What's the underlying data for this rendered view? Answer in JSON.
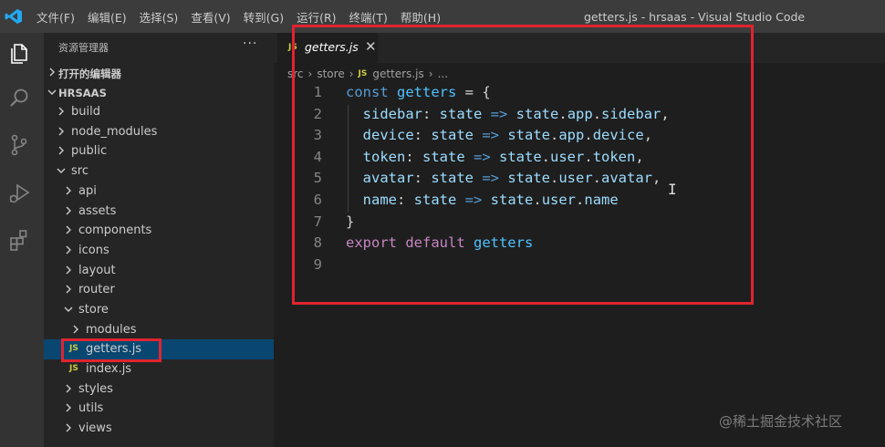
{
  "window": {
    "menu": [
      "文件(F)",
      "编辑(E)",
      "选择(S)",
      "查看(V)",
      "转到(G)",
      "运行(R)",
      "终端(T)",
      "帮助(H)"
    ],
    "title": "getters.js - hrsaas - Visual Studio Code"
  },
  "activity_bar": {
    "items": [
      "files-icon",
      "search-icon",
      "source-control-icon",
      "run-debug-icon",
      "extensions-icon"
    ]
  },
  "sidebar": {
    "header": "资源管理器",
    "more": "···",
    "open_editors": "打开的编辑器",
    "project": "HRSAAS",
    "tree": [
      {
        "label": "build",
        "type": "folder",
        "level": 1,
        "expanded": false
      },
      {
        "label": "node_modules",
        "type": "folder",
        "level": 1,
        "expanded": false
      },
      {
        "label": "public",
        "type": "folder",
        "level": 1,
        "expanded": false
      },
      {
        "label": "src",
        "type": "folder",
        "level": 1,
        "expanded": true
      },
      {
        "label": "api",
        "type": "folder",
        "level": 2,
        "expanded": false
      },
      {
        "label": "assets",
        "type": "folder",
        "level": 2,
        "expanded": false
      },
      {
        "label": "components",
        "type": "folder",
        "level": 2,
        "expanded": false
      },
      {
        "label": "icons",
        "type": "folder",
        "level": 2,
        "expanded": false
      },
      {
        "label": "layout",
        "type": "folder",
        "level": 2,
        "expanded": false
      },
      {
        "label": "router",
        "type": "folder",
        "level": 2,
        "expanded": false
      },
      {
        "label": "store",
        "type": "folder",
        "level": 2,
        "expanded": true
      },
      {
        "label": "modules",
        "type": "folder",
        "level": 3,
        "expanded": false
      },
      {
        "label": "getters.js",
        "type": "file",
        "level": 3,
        "selected": true
      },
      {
        "label": "index.js",
        "type": "file",
        "level": 3
      },
      {
        "label": "styles",
        "type": "folder",
        "level": 2,
        "expanded": false
      },
      {
        "label": "utils",
        "type": "folder",
        "level": 2,
        "expanded": false
      },
      {
        "label": "views",
        "type": "folder",
        "level": 2,
        "expanded": false
      }
    ]
  },
  "editor": {
    "tab": {
      "badge": "JS",
      "label": "getters.js",
      "close": "✕"
    },
    "breadcrumb": [
      "src",
      "store",
      "getters.js",
      "..."
    ],
    "code_lines": [
      [
        {
          "t": "const ",
          "c": "kw"
        },
        {
          "t": "getters",
          "c": "var"
        },
        {
          "t": " = {",
          "c": "pn"
        }
      ],
      [
        {
          "t": "  sidebar",
          "c": "prop"
        },
        {
          "t": ": ",
          "c": "pn"
        },
        {
          "t": "state",
          "c": "prop"
        },
        {
          "t": " => ",
          "c": "kw"
        },
        {
          "t": "state",
          "c": "prop"
        },
        {
          "t": ".",
          "c": "pn"
        },
        {
          "t": "app",
          "c": "prop"
        },
        {
          "t": ".",
          "c": "pn"
        },
        {
          "t": "sidebar",
          "c": "prop"
        },
        {
          "t": ",",
          "c": "pn"
        }
      ],
      [
        {
          "t": "  device",
          "c": "prop"
        },
        {
          "t": ": ",
          "c": "pn"
        },
        {
          "t": "state",
          "c": "prop"
        },
        {
          "t": " => ",
          "c": "kw"
        },
        {
          "t": "state",
          "c": "prop"
        },
        {
          "t": ".",
          "c": "pn"
        },
        {
          "t": "app",
          "c": "prop"
        },
        {
          "t": ".",
          "c": "pn"
        },
        {
          "t": "device",
          "c": "prop"
        },
        {
          "t": ",",
          "c": "pn"
        }
      ],
      [
        {
          "t": "  token",
          "c": "prop"
        },
        {
          "t": ": ",
          "c": "pn"
        },
        {
          "t": "state",
          "c": "prop"
        },
        {
          "t": " => ",
          "c": "kw"
        },
        {
          "t": "state",
          "c": "prop"
        },
        {
          "t": ".",
          "c": "pn"
        },
        {
          "t": "user",
          "c": "prop"
        },
        {
          "t": ".",
          "c": "pn"
        },
        {
          "t": "token",
          "c": "prop"
        },
        {
          "t": ",",
          "c": "pn"
        }
      ],
      [
        {
          "t": "  avatar",
          "c": "prop"
        },
        {
          "t": ": ",
          "c": "pn"
        },
        {
          "t": "state",
          "c": "prop"
        },
        {
          "t": " => ",
          "c": "kw"
        },
        {
          "t": "state",
          "c": "prop"
        },
        {
          "t": ".",
          "c": "pn"
        },
        {
          "t": "user",
          "c": "prop"
        },
        {
          "t": ".",
          "c": "pn"
        },
        {
          "t": "avatar",
          "c": "prop"
        },
        {
          "t": ",",
          "c": "pn"
        }
      ],
      [
        {
          "t": "  name",
          "c": "prop"
        },
        {
          "t": ": ",
          "c": "pn"
        },
        {
          "t": "state",
          "c": "prop"
        },
        {
          "t": " => ",
          "c": "kw"
        },
        {
          "t": "state",
          "c": "prop"
        },
        {
          "t": ".",
          "c": "pn"
        },
        {
          "t": "user",
          "c": "prop"
        },
        {
          "t": ".",
          "c": "pn"
        },
        {
          "t": "name",
          "c": "prop"
        }
      ],
      [
        {
          "t": "}",
          "c": "pn"
        }
      ],
      [
        {
          "t": "export ",
          "c": "kw2"
        },
        {
          "t": "default ",
          "c": "kw2"
        },
        {
          "t": "getters",
          "c": "var"
        }
      ],
      []
    ]
  },
  "colors": {
    "annotation": "#e0242f",
    "selection": "#094771",
    "js_badge": "#cbcb41"
  },
  "watermark": "@稀土掘金技术社区"
}
